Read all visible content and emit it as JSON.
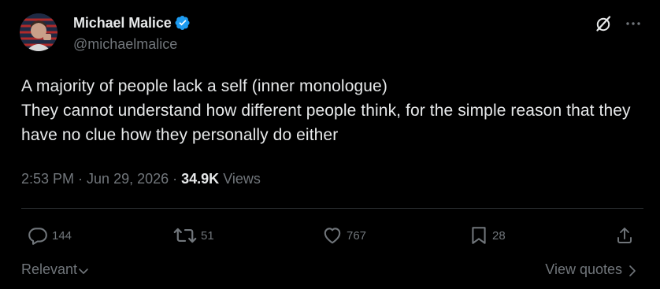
{
  "author": {
    "display_name": "Michael Malice",
    "handle": "@michaelmalice",
    "verified": true,
    "verified_color": "#1d9bf0"
  },
  "tweet": {
    "text": "A majority of people lack a self (inner monologue)\nThey cannot understand how different people think, for the simple reason that they have no clue how they personally do either",
    "time": "2:53 PM",
    "date": "Jun 29, 2026",
    "views_count": "34.9K",
    "views_label": "Views"
  },
  "actions": {
    "replies": "144",
    "reposts": "51",
    "likes": "767",
    "bookmarks": "28"
  },
  "footer": {
    "sort_label": "Relevant",
    "view_quotes_label": "View quotes"
  },
  "icons": {
    "header": [
      "grok-icon",
      "more-icon"
    ],
    "actions": [
      "reply-icon",
      "repost-icon",
      "like-icon",
      "bookmark-icon",
      "share-icon"
    ]
  },
  "colors": {
    "background": "#000000",
    "text_primary": "#e7e9ea",
    "text_secondary": "#71767b",
    "divider": "#2f3336"
  }
}
